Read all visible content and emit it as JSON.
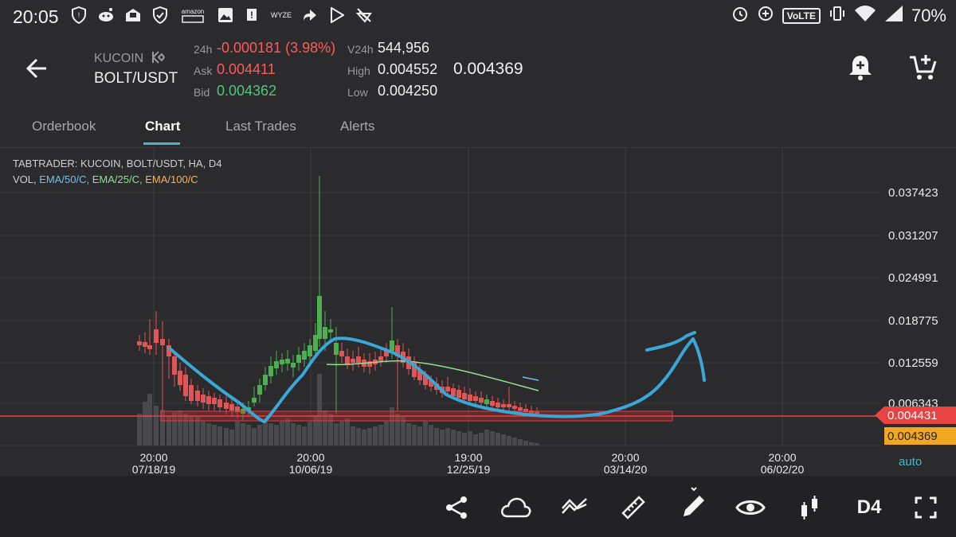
{
  "status_bar": {
    "time": "20:05",
    "battery": "70%",
    "network": "VoLTE",
    "left_icons": [
      "shield-icon",
      "reddit-icon",
      "mail-icon",
      "check-shield-icon",
      "amazon-icon",
      "image-icon",
      "notify-icon",
      "wyze-icon",
      "forward-icon",
      "play-store-icon",
      "no-location-icon"
    ],
    "amazon_text": "amazon",
    "wyze_text": "WYZE"
  },
  "header": {
    "exchange": "KUCOIN",
    "pair": "BOLT/USDT",
    "labels": {
      "change": "24h",
      "ask": "Ask",
      "bid": "Bid",
      "vol": "V24h",
      "high": "High",
      "low": "Low"
    },
    "change": "-0.000181 (3.98%)",
    "ask": "0.004411",
    "bid": "0.004362",
    "vol": "544,956",
    "high": "0.004552",
    "low": "0.004250",
    "last": "0.004369"
  },
  "tabs": [
    {
      "label": "Orderbook",
      "active": false
    },
    {
      "label": "Chart",
      "active": true
    },
    {
      "label": "Last Trades",
      "active": false
    },
    {
      "label": "Alerts",
      "active": false
    }
  ],
  "chart": {
    "source_line": "TABTRADER: KUCOIN, BOLT/USDT, HA, D4",
    "indicators": {
      "vol": "VOL,",
      "ema50": "EMA/50/C,",
      "ema25": "EMA/25/C,",
      "ema100": "EMA/100/C"
    },
    "indicator_colors": {
      "ema50": "#6fc3e8",
      "ema25": "#8fe08f",
      "ema100": "#f3b55a"
    },
    "price_ticks": [
      "0.037423",
      "0.031207",
      "0.024991",
      "0.018775",
      "0.012559",
      "0.006343"
    ],
    "ask_tag": "0.004431",
    "last_tag": "0.004369",
    "time_ticks": [
      {
        "time": "20:00",
        "date": "07/18/19"
      },
      {
        "time": "20:00",
        "date": "10/06/19"
      },
      {
        "time": "19:00",
        "date": "12/25/19"
      },
      {
        "time": "20:00",
        "date": "03/14/20"
      },
      {
        "time": "20:00",
        "date": "06/02/20"
      }
    ],
    "auto_label": "auto",
    "colors": {
      "up": "#4caf50",
      "down": "#e05555",
      "drawing": "#3ba7d6",
      "ask_line": "#e84343",
      "last_tag": "#f1a820"
    }
  },
  "toolbar": {
    "icons": [
      "share-icon",
      "cloud-icon",
      "indicators-icon",
      "ruler-icon",
      "pencil-icon",
      "eye-icon",
      "candles-icon"
    ],
    "interval": "D4",
    "fullscreen": "fullscreen-icon"
  }
}
